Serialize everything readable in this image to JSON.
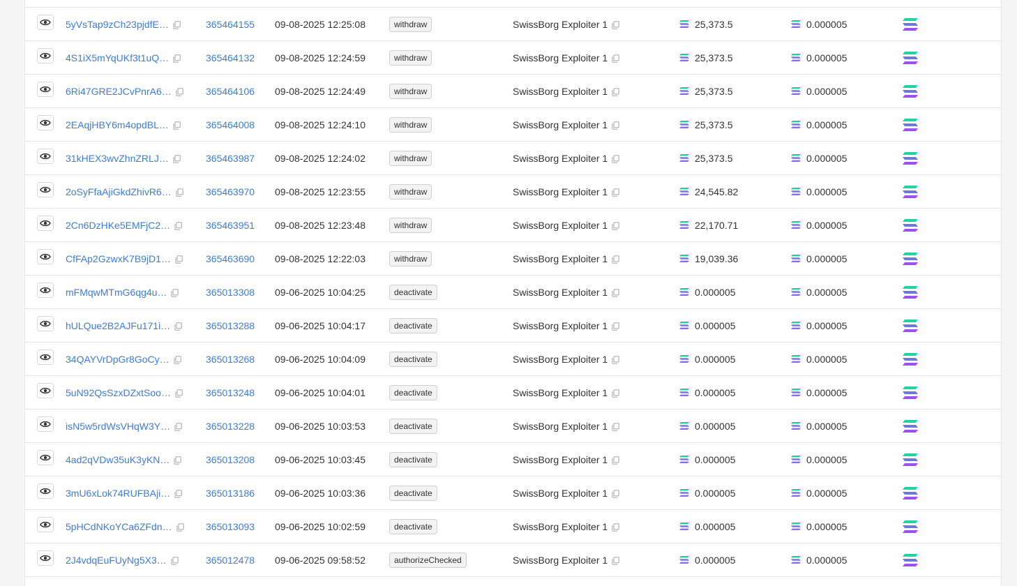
{
  "icons": {
    "view": "eye-icon",
    "copy": "copy-icon",
    "token": "solana-token-icon",
    "program": "solana-program-icon"
  },
  "colors": {
    "link": "#3b7ddd",
    "sol_teal": "#1dd6b0",
    "sol_purple": "#9945ff"
  },
  "transactions": [
    {
      "signature": "5yVsTap9zCh23pjdfE…",
      "block": "365464155",
      "time": "09-08-2025 12:25:08",
      "instruction": "withdraw",
      "by": "SwissBorg Exploiter 1",
      "amount": "25,373.5",
      "fee": "0.000005"
    },
    {
      "signature": "4S1iX5mYqUKf3t1uQ…",
      "block": "365464132",
      "time": "09-08-2025 12:24:59",
      "instruction": "withdraw",
      "by": "SwissBorg Exploiter 1",
      "amount": "25,373.5",
      "fee": "0.000005"
    },
    {
      "signature": "6Ri47GRE2JCvPnrA6…",
      "block": "365464106",
      "time": "09-08-2025 12:24:49",
      "instruction": "withdraw",
      "by": "SwissBorg Exploiter 1",
      "amount": "25,373.5",
      "fee": "0.000005"
    },
    {
      "signature": "2EAqjHBY6m4opdBL…",
      "block": "365464008",
      "time": "09-08-2025 12:24:10",
      "instruction": "withdraw",
      "by": "SwissBorg Exploiter 1",
      "amount": "25,373.5",
      "fee": "0.000005"
    },
    {
      "signature": "31kHEX3wvZhnZRLJ…",
      "block": "365463987",
      "time": "09-08-2025 12:24:02",
      "instruction": "withdraw",
      "by": "SwissBorg Exploiter 1",
      "amount": "25,373.5",
      "fee": "0.000005"
    },
    {
      "signature": "2oSyFfaAjiGkdZhivR6…",
      "block": "365463970",
      "time": "09-08-2025 12:23:55",
      "instruction": "withdraw",
      "by": "SwissBorg Exploiter 1",
      "amount": "24,545.82",
      "fee": "0.000005"
    },
    {
      "signature": "2Cn6DzHKe5EMFjC2…",
      "block": "365463951",
      "time": "09-08-2025 12:23:48",
      "instruction": "withdraw",
      "by": "SwissBorg Exploiter 1",
      "amount": "22,170.71",
      "fee": "0.000005"
    },
    {
      "signature": "CfFAp2GzwxK7B9jD1…",
      "block": "365463690",
      "time": "09-08-2025 12:22:03",
      "instruction": "withdraw",
      "by": "SwissBorg Exploiter 1",
      "amount": "19,039.36",
      "fee": "0.000005"
    },
    {
      "signature": "mFMqwMTmG6qg4u…",
      "block": "365013308",
      "time": "09-06-2025 10:04:25",
      "instruction": "deactivate",
      "by": "SwissBorg Exploiter 1",
      "amount": "0.000005",
      "fee": "0.000005"
    },
    {
      "signature": "hULQue2B2AJFu171i…",
      "block": "365013288",
      "time": "09-06-2025 10:04:17",
      "instruction": "deactivate",
      "by": "SwissBorg Exploiter 1",
      "amount": "0.000005",
      "fee": "0.000005"
    },
    {
      "signature": "34QAYVrDpGr8GoCy…",
      "block": "365013268",
      "time": "09-06-2025 10:04:09",
      "instruction": "deactivate",
      "by": "SwissBorg Exploiter 1",
      "amount": "0.000005",
      "fee": "0.000005"
    },
    {
      "signature": "5uN92QsSzxDZxtSoo…",
      "block": "365013248",
      "time": "09-06-2025 10:04:01",
      "instruction": "deactivate",
      "by": "SwissBorg Exploiter 1",
      "amount": "0.000005",
      "fee": "0.000005"
    },
    {
      "signature": "isN5w5rdWsVHqW3Y…",
      "block": "365013228",
      "time": "09-06-2025 10:03:53",
      "instruction": "deactivate",
      "by": "SwissBorg Exploiter 1",
      "amount": "0.000005",
      "fee": "0.000005"
    },
    {
      "signature": "4ad2qVDw35uK3yKN…",
      "block": "365013208",
      "time": "09-06-2025 10:03:45",
      "instruction": "deactivate",
      "by": "SwissBorg Exploiter 1",
      "amount": "0.000005",
      "fee": "0.000005"
    },
    {
      "signature": "3mU6xLok74RUFBAji…",
      "block": "365013186",
      "time": "09-06-2025 10:03:36",
      "instruction": "deactivate",
      "by": "SwissBorg Exploiter 1",
      "amount": "0.000005",
      "fee": "0.000005"
    },
    {
      "signature": "5pHCdNKoYCa6ZFdn…",
      "block": "365013093",
      "time": "09-06-2025 10:02:59",
      "instruction": "deactivate",
      "by": "SwissBorg Exploiter 1",
      "amount": "0.000005",
      "fee": "0.000005"
    },
    {
      "signature": "2J4vdqEuFUyNg5X3…",
      "block": "365012478",
      "time": "09-06-2025 09:58:52",
      "instruction": "authorizeChecked",
      "by": "SwissBorg Exploiter 1",
      "amount": "0.000005",
      "fee": "0.000005"
    }
  ]
}
